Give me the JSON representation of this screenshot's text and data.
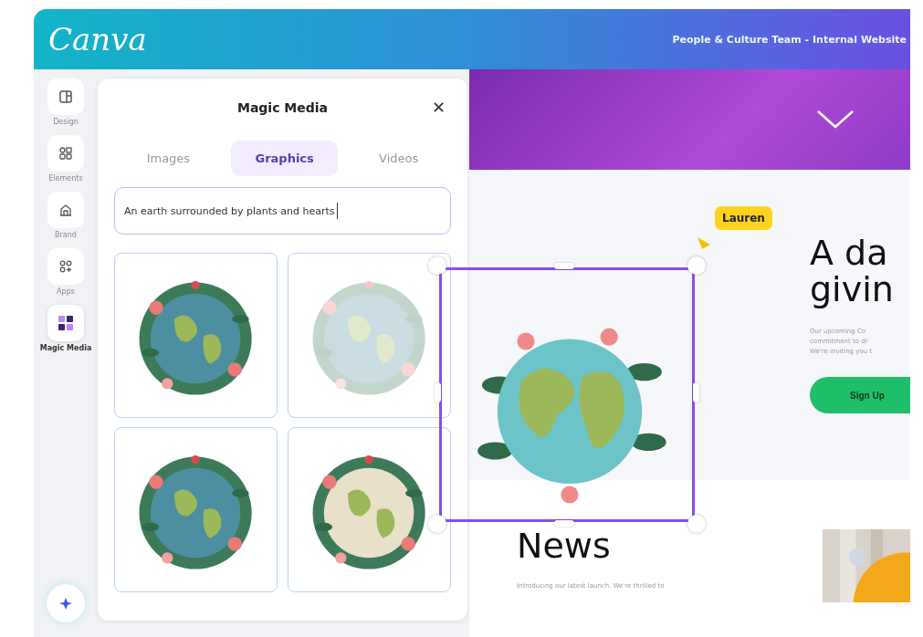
{
  "header": {
    "logo": "Canva",
    "site_title": "People & Culture Team - Internal Website"
  },
  "rail": [
    {
      "label": "Design",
      "selected": false
    },
    {
      "label": "Elements",
      "selected": false
    },
    {
      "label": "Brand",
      "selected": false
    },
    {
      "label": "Apps",
      "selected": false
    },
    {
      "label": "Magic Media",
      "selected": true
    }
  ],
  "panel": {
    "title": "Magic Media",
    "close": "✕",
    "tabs": [
      {
        "label": "Images",
        "selected": false
      },
      {
        "label": "Graphics",
        "selected": true
      },
      {
        "label": "Videos",
        "selected": false
      }
    ],
    "prompt": {
      "value": "An earth surrounded by plants and hearts"
    },
    "results": [
      {
        "kind": "picture",
        "loading": false
      },
      {
        "kind": "picture",
        "loading": true
      },
      {
        "kind": "picture",
        "loading": false
      },
      {
        "kind": "picture",
        "loading": false
      }
    ]
  },
  "canvas": {
    "cursor_label": "Lauren",
    "hero": {
      "heading_lines": [
        "A da",
        "givin"
      ],
      "body_lines": [
        "Our upcoming Co",
        "commitment to dr",
        "We're inviting you t"
      ],
      "button": "Sign Up"
    },
    "news": {
      "heading": "News",
      "body": "Introducing our latest launch. We're thrilled to"
    }
  }
}
